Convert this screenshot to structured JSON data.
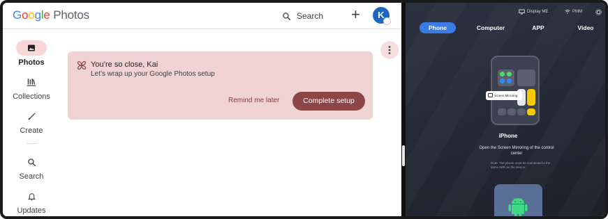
{
  "google_photos": {
    "logo": {
      "G": "G",
      "o1": "o",
      "o2": "o",
      "g": "g",
      "l": "l",
      "e": "e",
      "rest": " Photos"
    },
    "header": {
      "search_label": "Search"
    },
    "avatar_initial": "K",
    "nav": {
      "photos": "Photos",
      "collections": "Collections",
      "create": "Create",
      "search": "Search",
      "updates": "Updates"
    },
    "setup_card": {
      "title": "You’re so close, Kai",
      "subtitle": "Let’s wrap up your Google Photos setup",
      "remind_label": "Remind me later",
      "complete_label": "Complete setup"
    }
  },
  "mirroring": {
    "status": {
      "display": "Display ME",
      "wifi": "PMM"
    },
    "tabs": [
      "Phone",
      "Computer",
      "APP",
      "Video"
    ],
    "active_tab": "Phone",
    "callout": "Screen Mirroring",
    "device_title": "iPhone",
    "description": "Open the Screen Mirroring of the control center",
    "note": "Note: The phone must be connected to the same WiFi as the device."
  },
  "colors": {
    "card_bg": "#f2d3d3",
    "complete_button": "#8c4646",
    "active_tab": "#3b7be8",
    "android_green": "#3ddc84"
  }
}
